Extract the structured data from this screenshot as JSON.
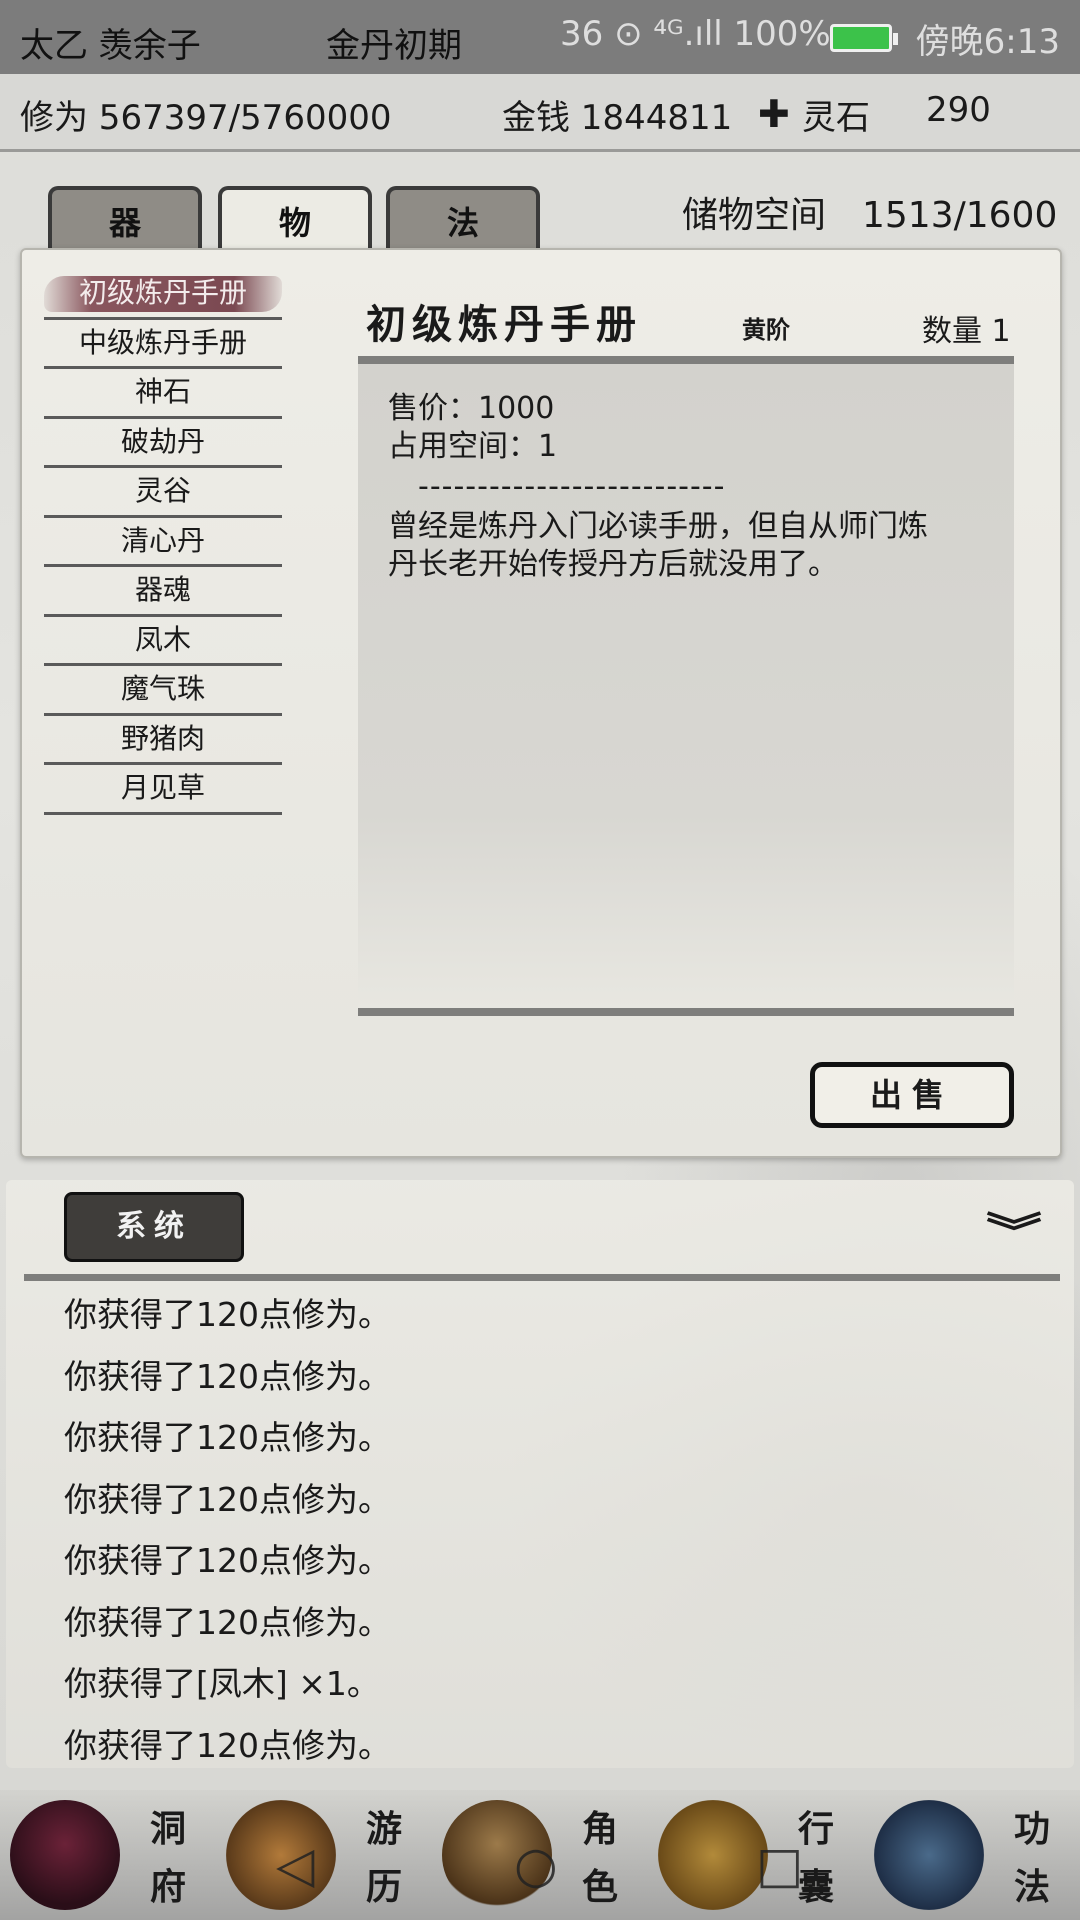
{
  "topbar": {
    "char_name": "太乙 羡余子",
    "realm": "金丹初期",
    "status_overlay": "36 ⊙ ⁴ᴳ.ıll 100%",
    "time": "傍晚6:13"
  },
  "stats": {
    "xiuwei": "修为 567397/5760000",
    "money": "金钱 1844811",
    "lingshi_icon": "✚",
    "lingshi_label": "灵石",
    "lingshi_value": "290"
  },
  "tabs": [
    {
      "label": "器",
      "active": false
    },
    {
      "label": "物",
      "active": true
    },
    {
      "label": "法",
      "active": false
    }
  ],
  "storage": "储物空间　1513/1600",
  "items": [
    "初级炼丹手册",
    "中级炼丹手册",
    "神石",
    "破劫丹",
    "灵谷",
    "清心丹",
    "器魂",
    "凤木",
    "魔气珠",
    "野猪肉",
    "月见草"
  ],
  "detail": {
    "title": "初级炼丹手册",
    "grade": "黄阶",
    "quantity": "数量 1",
    "price": "售价：1000",
    "space": "占用空间：1",
    "divider": "--------------------------",
    "description_1": "曾经是炼丹入门必读手册，但自从师门炼",
    "description_2": "丹长老开始传授丹方后就没用了。",
    "sell_label": "出售"
  },
  "log": {
    "tab_label": "系统",
    "collapse_icon": "chevron-double-down",
    "lines": [
      "你获得了120点修为。",
      "你获得了120点修为。",
      "你获得了120点修为。",
      "你获得了120点修为。",
      "你获得了120点修为。",
      "你获得了120点修为。",
      "你获得了[凤木] ×1。",
      "你获得了120点修为。"
    ]
  },
  "nav": [
    {
      "label_1": "洞",
      "label_2": "府"
    },
    {
      "label_1": "游",
      "label_2": "历"
    },
    {
      "label_1": "角",
      "label_2": "色"
    },
    {
      "label_1": "行",
      "label_2": "囊"
    },
    {
      "label_1": "功",
      "label_2": "法"
    }
  ],
  "system_nav": {
    "back": "◁",
    "home": "○",
    "recents": "□"
  }
}
